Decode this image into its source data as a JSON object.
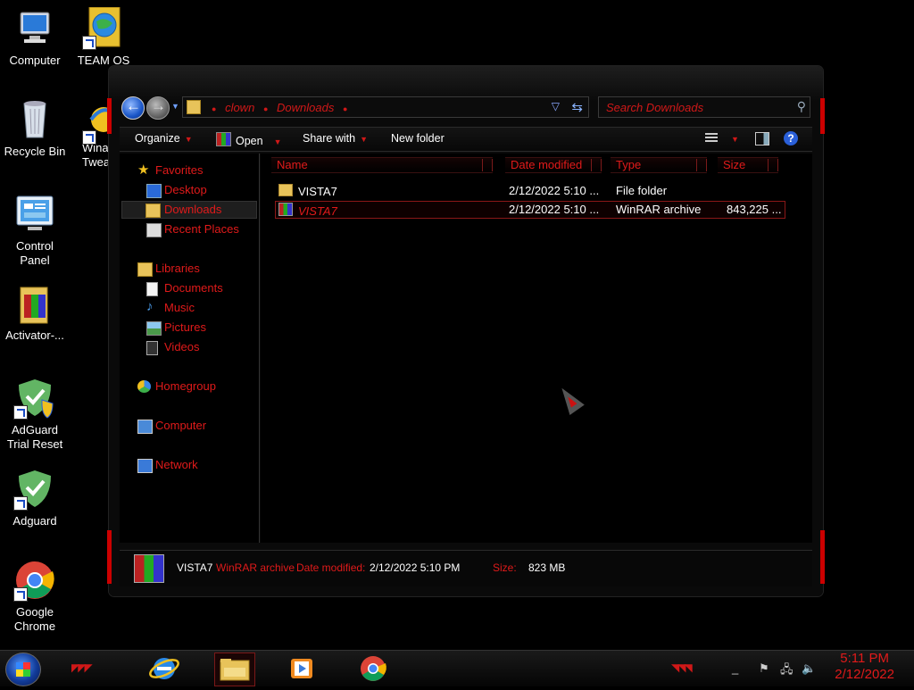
{
  "desktop": {
    "icons": [
      {
        "label": "Computer"
      },
      {
        "label": "TEAM OS"
      },
      {
        "label": "Recycle Bin"
      },
      {
        "label": "Wina..."
      },
      {
        "label": "Tweak"
      },
      {
        "label": "Control Panel"
      },
      {
        "label": "Activator-..."
      },
      {
        "label": "AdGuard Trial Reset"
      },
      {
        "label": "Adguard"
      },
      {
        "label": "Google Chrome"
      }
    ]
  },
  "explorer": {
    "address": {
      "crumbs": [
        "clown",
        "Downloads"
      ]
    },
    "search": {
      "placeholder": "Search Downloads"
    },
    "toolbar": {
      "organize": "Organize",
      "open": "Open",
      "share_with": "Share with",
      "new_folder": "New folder"
    },
    "nav": {
      "favorites": "Favorites",
      "desktop": "Desktop",
      "downloads": "Downloads",
      "recent": "Recent Places",
      "libraries": "Libraries",
      "documents": "Documents",
      "music": "Music",
      "pictures": "Pictures",
      "videos": "Videos",
      "homegroup": "Homegroup",
      "computer": "Computer",
      "network": "Network"
    },
    "columns": {
      "name": "Name",
      "date": "Date modified",
      "type": "Type",
      "size": "Size"
    },
    "files": [
      {
        "name": "VISTA7",
        "date": "2/12/2022 5:10 ...",
        "type": "File folder",
        "size": ""
      },
      {
        "name": "VISTA7",
        "date": "2/12/2022 5:10 ...",
        "type": "WinRAR archive",
        "size": "843,225 ..."
      }
    ],
    "details": {
      "name": "VISTA7",
      "type": "WinRAR archive",
      "date_label": "Date modified:",
      "date": "2/12/2022 5:10 PM",
      "size_label": "Size:",
      "size": "823 MB"
    }
  },
  "taskbar": {
    "time": "5:11 PM",
    "date": "2/12/2022"
  }
}
